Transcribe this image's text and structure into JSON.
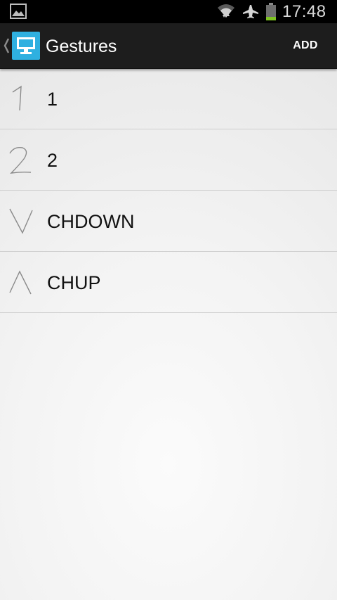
{
  "status_bar": {
    "time": "17:48",
    "icons": [
      "gallery-icon",
      "wifi-icon",
      "airplane-icon",
      "battery-icon"
    ]
  },
  "action_bar": {
    "title": "Gestures",
    "add_label": "ADD",
    "app_icon": "tv-monitor-icon"
  },
  "gestures": [
    {
      "name": "1",
      "thumbnail": "gesture-1-icon"
    },
    {
      "name": "2",
      "thumbnail": "gesture-2-icon"
    },
    {
      "name": "CHDOWN",
      "thumbnail": "gesture-v-icon"
    },
    {
      "name": "CHUP",
      "thumbnail": "gesture-caret-icon"
    }
  ],
  "colors": {
    "accent": "#2fb0e0",
    "action_bar": "#1d1d1d",
    "battery_level": "#7ec421"
  }
}
